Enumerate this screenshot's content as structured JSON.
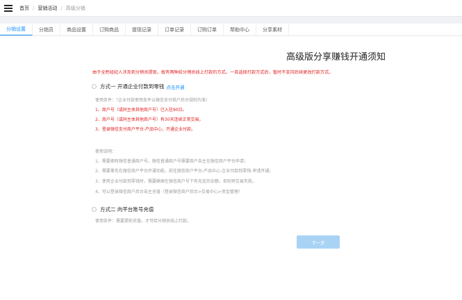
{
  "breadcrumb": [
    "首页",
    "营销活动",
    "高级分销"
  ],
  "tabs": [
    "分销设置",
    "分销员",
    "商品设置",
    "订购商品",
    "提现记录",
    "订单记录",
    "订购订单",
    "帮助中心",
    "分享素材"
  ],
  "main": {
    "title": "高级版分享赚钱开通须知",
    "warning": "由于全民经纪人涉及到分销员提现，故有两种给分销员线上打款的方式。一旦选择打款方式后，暂时不支持后续更改打款方式。",
    "option1": {
      "label": "方式一 开通企业付款到零钱",
      "link": "点击开通",
      "condition_title": "使用条件：（企业付款使用条件以微信支付商户后台规则为准）",
      "conditions": [
        "1、商户号（或同主体其他商户号）已入驻90日。",
        "2、商户号（或同主体其他商户号）有30天连续正常交易。",
        "3、登录微信支付商户平台-产品中心，开通企业付款。"
      ],
      "usage_title": "使用说明：",
      "usage": [
        "1、需要拥有微信普通商户号。微信普通商户号需要商户自主在微信商户平台申请；",
        "2、需要事先在微信商户平台开通功能，前往微信商户平台-产品中心-企业付款到零钱-申请开通；",
        "3、使用企业付款到零钱时，需要确保在微信商户号下有充足的余额，否则将交易失败。",
        "4、可以登录微信商户后台自主充值（登录微信商户后台>交易中心>资金管理）"
      ]
    },
    "option2": {
      "label": "方式二 向平台账号充值",
      "condition": "使用条件：需要提前充值，才可给分销员线上打款。"
    },
    "next_button": "下一步"
  }
}
